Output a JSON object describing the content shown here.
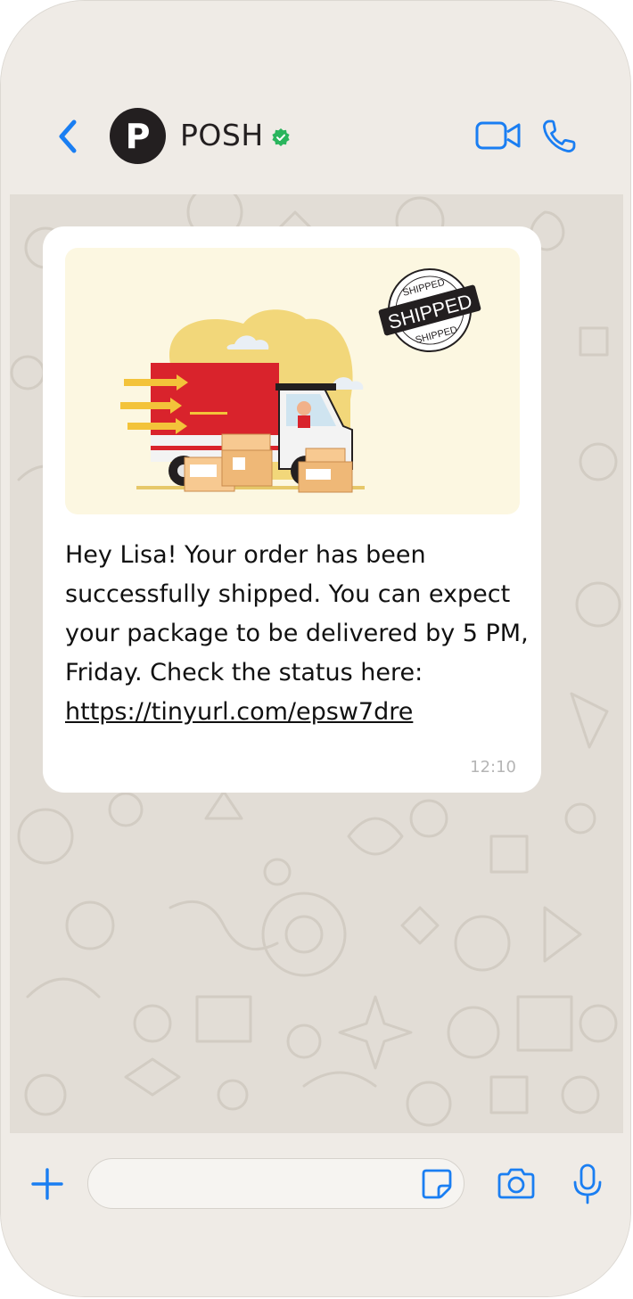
{
  "header": {
    "contact_name": "POSH",
    "avatar_letter": "P"
  },
  "message": {
    "text_before_link": "Hey Lisa! Your order has been successfully shipped. You can expect your package to be delivered by 5 PM, Friday. Check the status here: ",
    "link": "https://tinyurl.com/epsw7dre",
    "time": "12:10",
    "image": {
      "stamp_text": "SHIPPED",
      "stamp_ring_text_top": "SHIPPED",
      "stamp_ring_text_bottom": "SHIPPED"
    }
  },
  "composer": {
    "placeholder": ""
  },
  "colors": {
    "accent_blue": "#1a7ef2",
    "verified_green": "#2ab55d",
    "chat_background": "#e2ddd6"
  }
}
